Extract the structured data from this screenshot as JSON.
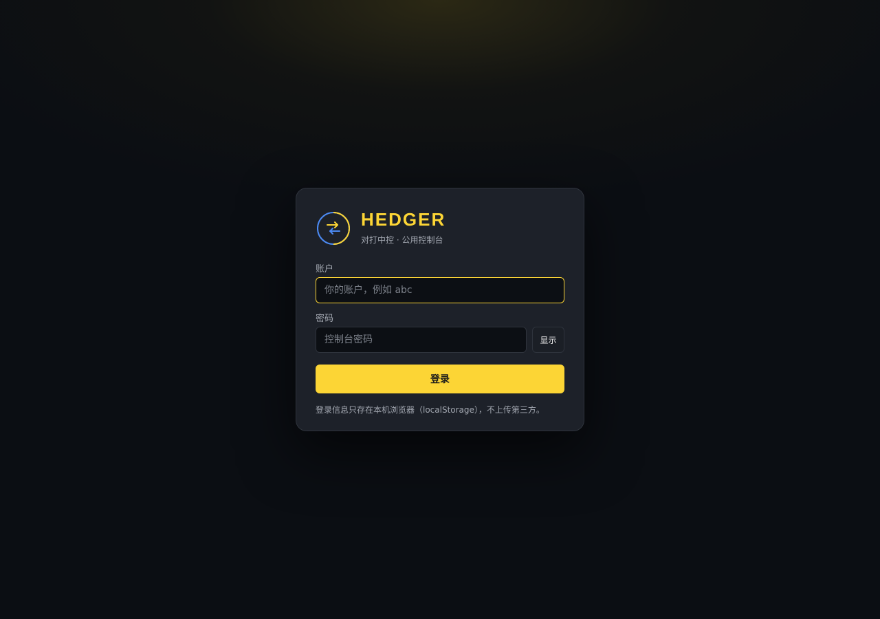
{
  "brand": {
    "title": "HEDGER",
    "subtitle": "对打中控 · 公用控制台",
    "logo_icon": "swap-arrows-icon"
  },
  "form": {
    "account_label": "账户",
    "account_placeholder": "你的账户，例如 abc",
    "account_value": "",
    "password_label": "密码",
    "password_placeholder": "控制台密码",
    "password_value": "",
    "show_password_label": "显示",
    "login_label": "登录"
  },
  "note": "登录信息只存在本机浏览器（localStorage），不上传第三方。",
  "colors": {
    "accent": "#fcd535",
    "logo_blue": "#4c8bf5",
    "background": "#0b0e13",
    "card": "#1d2129"
  }
}
